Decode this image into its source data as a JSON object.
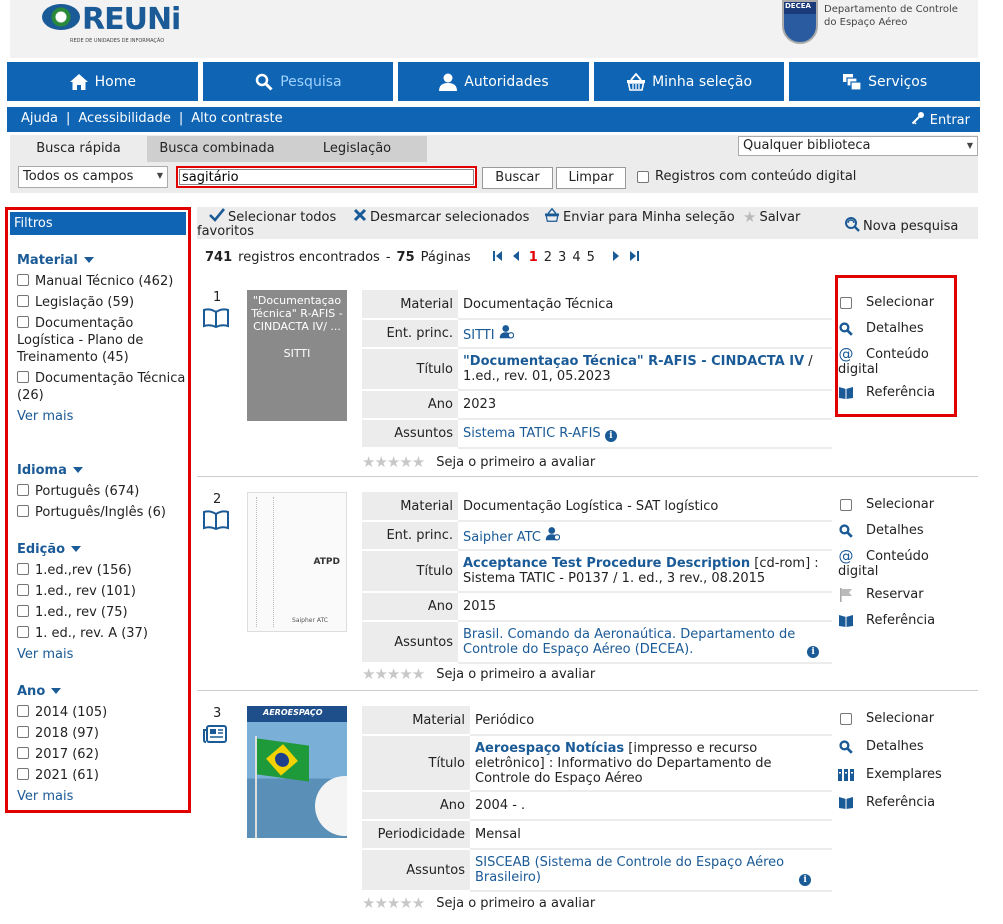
{
  "header": {
    "logo_text": "REUNi",
    "logo_subtitle": "REDE DE UNIDADES DE INFORMAÇÃO",
    "decea_badge": "DECEA",
    "decea_line1": "Departamento de Controle",
    "decea_line2": "do Espaço Aéreo"
  },
  "nav": {
    "home": "Home",
    "search": "Pesquisa",
    "authorities": "Autoridades",
    "selection": "Minha seleção",
    "services": "Serviços"
  },
  "subnav": {
    "help": "Ajuda",
    "accessibility": "Acessibilidade",
    "contrast": "Alto contraste",
    "sep": "|",
    "login": "Entrar"
  },
  "search": {
    "tab_quick": "Busca rápida",
    "tab_combined": "Busca combinada",
    "tab_legislation": "Legislação",
    "library": "Qualquer biblioteca",
    "field": "Todos os campos",
    "query": "sagitário",
    "search_button": "Buscar",
    "clear_button": "Limpar",
    "digital_label": "Registros com conteúdo digital"
  },
  "filters": {
    "title": "Filtros",
    "more": "Ver mais",
    "sections": [
      {
        "title": "Material",
        "items": [
          "Manual Técnico (462)",
          "Legislação (59)",
          "Documentação Logística - Plano de Treinamento (45)",
          "Documentação Técnica (26)"
        ]
      },
      {
        "title": "Idioma",
        "items": [
          "Português (674)",
          "Português/Inglês (6)"
        ]
      },
      {
        "title": "Edição",
        "items": [
          "1.ed.,rev (156)",
          "1.ed., rev (101)",
          "1.ed., rev (75)",
          "1. ed., rev. A (37)"
        ]
      },
      {
        "title": "Ano",
        "items": [
          "2014 (105)",
          "2018 (97)",
          "2017 (62)",
          "2021 (61)"
        ]
      }
    ]
  },
  "toolbar": {
    "select_all_1": "Selecionar todos",
    "select_all_2": "favoritos",
    "deselect": "Desmarcar selecionados",
    "send": "Enviar para Minha seleção",
    "save": "Salvar",
    "new_search": "Nova pesquisa"
  },
  "results": {
    "count": "741",
    "count_label": "registros encontrados",
    "dash": "-",
    "pages": "75",
    "pages_label": "Páginas",
    "page_numbers": [
      "1",
      "2",
      "3",
      "4",
      "5"
    ],
    "rating_text": "Seja o primeiro a avaliar"
  },
  "actions": {
    "select": "Selecionar",
    "details": "Detalhes",
    "digital_1": "Conteúdo",
    "digital_2": "digital",
    "reserve": "Reservar",
    "reference": "Referência",
    "copies": "Exemplares"
  },
  "records": [
    {
      "number": "1",
      "thumb_text": "\"Documentaçao Técnica\" R-AFIS - CINDACTA IV/ ...",
      "thumb_author": "SITTI",
      "labels": {
        "material": "Material",
        "author": "Ent. princ.",
        "title": "Título",
        "year": "Ano",
        "subjects": "Assuntos"
      },
      "material": "Documentação Técnica",
      "author": "SITTI",
      "title_bold": "\"Documentaçao Técnica\" R-AFIS - CINDACTA IV",
      "title_rest": " / 1.ed., rev. 01, 05.2023",
      "year": "2023",
      "subjects": "Sistema TATIC R-AFIS"
    },
    {
      "number": "2",
      "thumb_text": "ATPD",
      "thumb_author": "Saipher ATC",
      "labels": {
        "material": "Material",
        "author": "Ent. princ.",
        "title": "Título",
        "year": "Ano",
        "subjects": "Assuntos"
      },
      "material": "Documentação Logística - SAT logístico",
      "author": "Saipher ATC",
      "title_bold": "Acceptance Test Procedure Description",
      "title_rest": " [cd-rom] : Sistema TATIC - P0137 / 1. ed., 3 rev., 08.2015",
      "year": "2015",
      "subjects": "Brasil. Comando da Aeronaútica. Departamento de Controle do Espaço Aéreo (DECEA)."
    },
    {
      "number": "3",
      "thumb_text": "AEROESPAÇO",
      "labels": {
        "material": "Material",
        "title": "Título",
        "year": "Ano",
        "period": "Periodicidade",
        "subjects": "Assuntos"
      },
      "material": "Periódico",
      "title_bold": "Aeroespaço Notícias",
      "title_rest": " [impresso e recurso eletrônico] : Informativo do Departamento de Controle do Espaço Aéreo",
      "year": "2004 - .",
      "period": "Mensal",
      "subjects": "SISCEAB (Sistema de Controle do Espaço Aéreo Brasileiro)"
    }
  ],
  "colors": {
    "primary": "#0f64b4",
    "link": "#1a5a96",
    "highlight": "#e00000",
    "panel": "#ececec"
  }
}
